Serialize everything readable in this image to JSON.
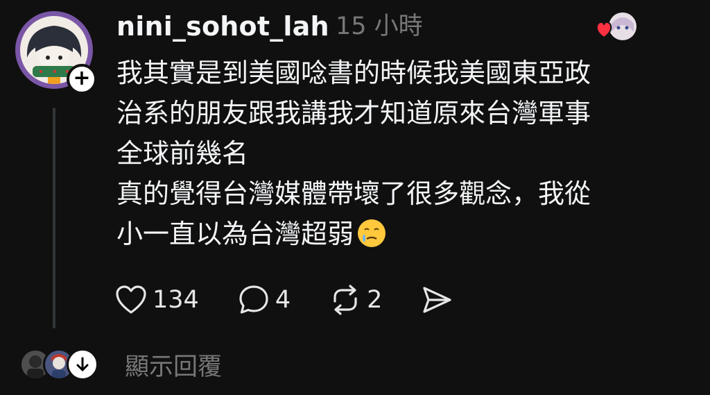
{
  "post": {
    "username": "nini_sohot_lah",
    "timestamp": "15 小時",
    "paragraphs": [
      "我其實是到美國唸書的時候我美國東亞政\n治系的朋友跟我講我才知道原來台灣軍事\n全球前幾名",
      "真的覺得台灣媒體帶壞了很多觀念，我從\n小一直以為台灣超弱"
    ],
    "emoji": "face-holding-back-tears"
  },
  "actions": {
    "likes": "134",
    "comments": "4",
    "reposts": "2"
  },
  "replies": {
    "label": "顯示回覆"
  },
  "colors": {
    "background": "#101010",
    "text": "#f3f5f7",
    "secondary": "#777777",
    "heart": "#ff3040",
    "avatar_ring": "#7a56a6"
  },
  "icons": {
    "follow": "plus-icon",
    "like": "heart-outline-icon",
    "comment": "speech-bubble-icon",
    "repost": "repost-icon",
    "share": "send-icon",
    "expand": "arrow-down-icon",
    "liker": "red-heart-icon"
  }
}
